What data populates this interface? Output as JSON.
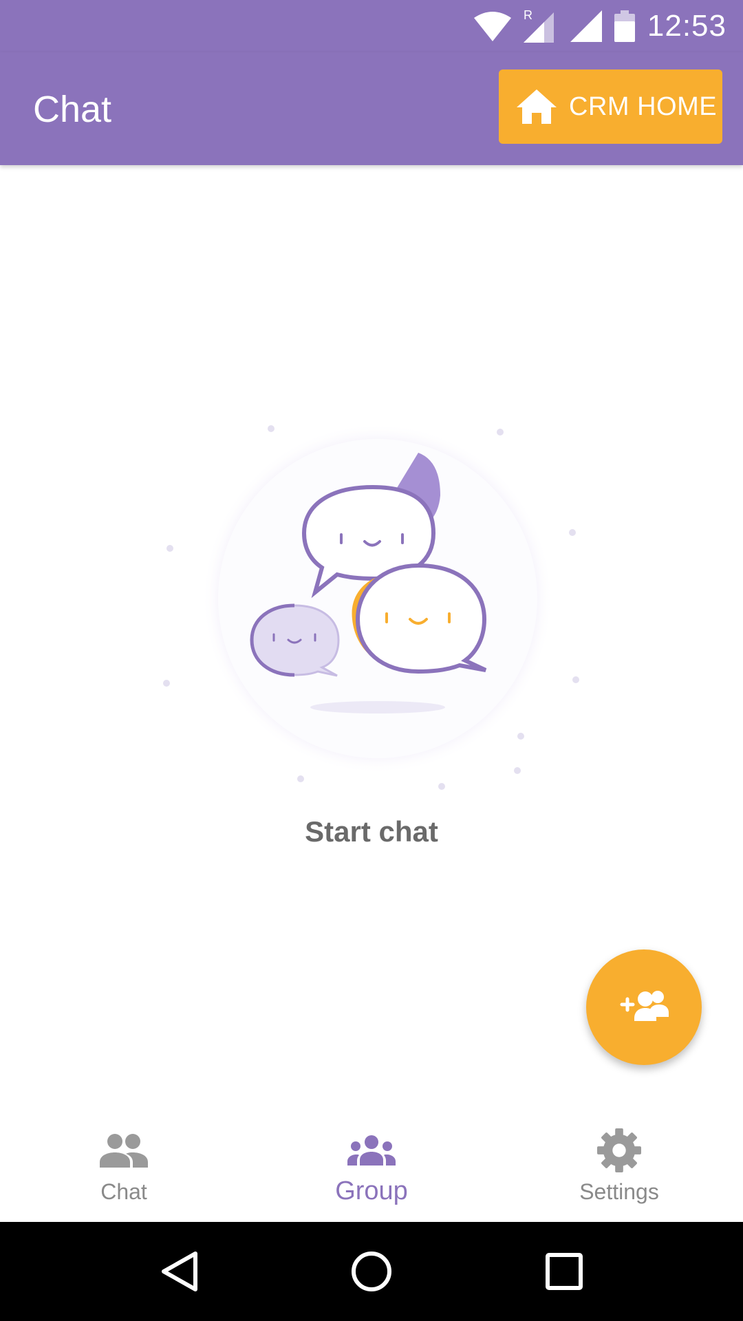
{
  "status_bar": {
    "time": "12:53",
    "icons": [
      "wifi-icon",
      "signal-roaming-icon",
      "signal-icon",
      "battery-icon"
    ]
  },
  "app_bar": {
    "title": "Chat",
    "crm_button_label": "CRM HOME",
    "crm_button_icon": "home-icon"
  },
  "empty_state": {
    "message": "Start chat",
    "illustration": "chat-bubbles-illustration"
  },
  "fab": {
    "icon": "add-group-icon"
  },
  "bottom_nav": {
    "items": [
      {
        "label": "Chat",
        "icon": "people-icon",
        "active": false
      },
      {
        "label": "Group",
        "icon": "group-icon",
        "active": true
      },
      {
        "label": "Settings",
        "icon": "gear-icon",
        "active": false
      }
    ]
  },
  "system_nav": {
    "icons": [
      "back-icon",
      "home-circle-icon",
      "recents-icon"
    ]
  },
  "colors": {
    "primary": "#8b73bb",
    "accent": "#f8ae2f",
    "inactive": "#8a8a8a",
    "text_muted": "#6a6a6a"
  }
}
